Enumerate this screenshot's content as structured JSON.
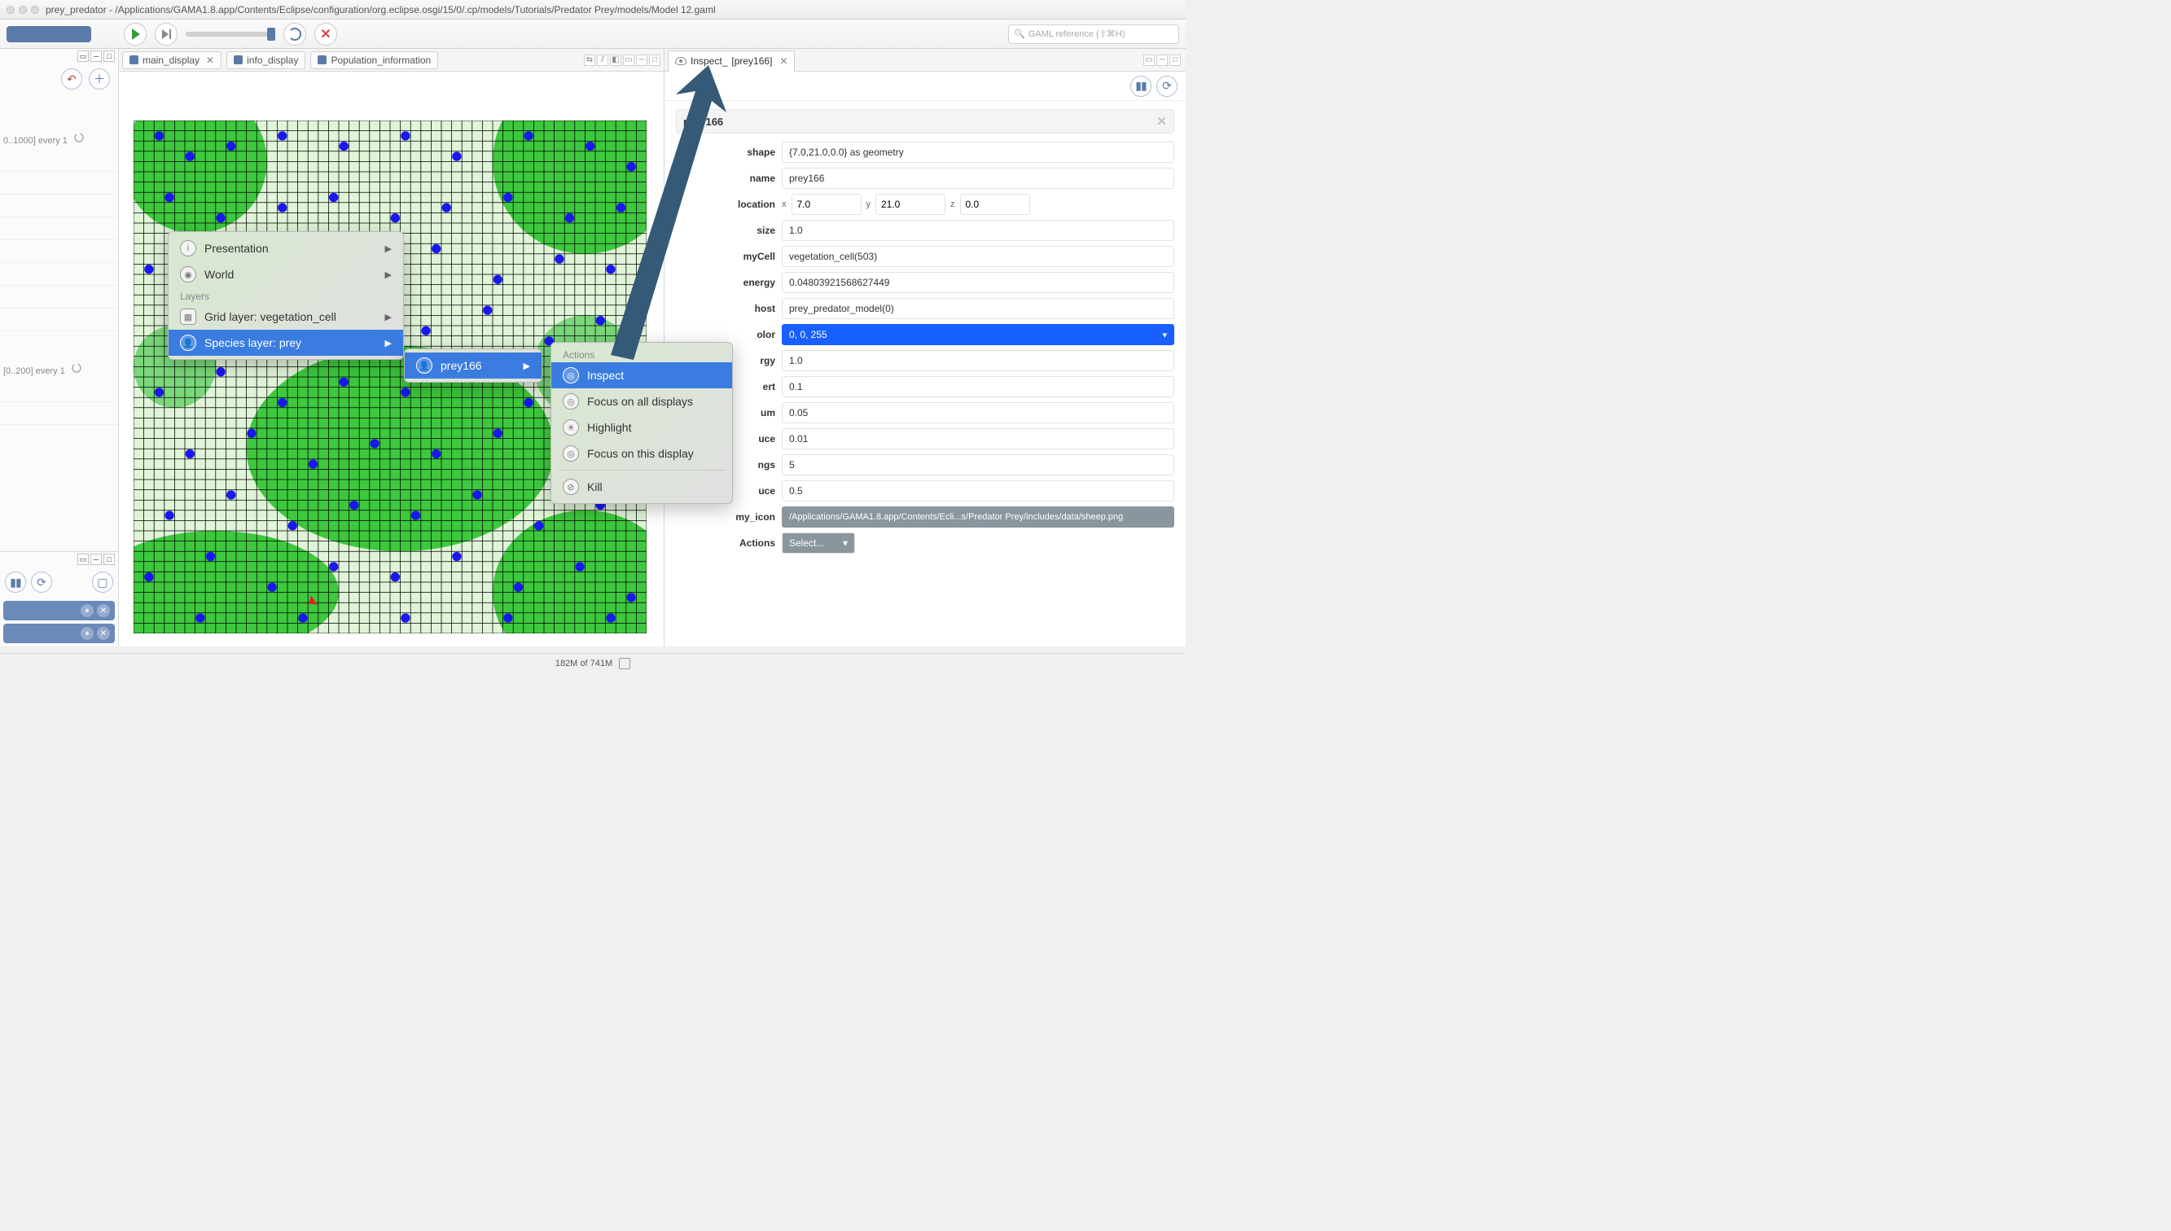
{
  "window": {
    "title": "prey_predator - /Applications/GAMA1.8.app/Contents/Eclipse/configuration/org.eclipse.osgi/15/0/.cp/models/Tutorials/Predator Prey/models/Model 12.gaml"
  },
  "toolbar": {
    "search_placeholder": "GAML reference (⇧⌘H)"
  },
  "left": {
    "param1": "0..1000] every 1",
    "param2": "[0..200] every 1"
  },
  "tabs": {
    "t1": "main_display",
    "t2": "info_display",
    "t3": "Population_information"
  },
  "inspect": {
    "tab_label_a": "Inspect_",
    "tab_label_b": "[prey166]",
    "agent_name": "prey166",
    "fields": {
      "shape": {
        "label": "shape",
        "value": "{7.0,21.0,0.0} as geometry"
      },
      "name": {
        "label": "name",
        "value": "prey166"
      },
      "location": {
        "label": "location",
        "xl": "x",
        "x": "7.0",
        "yl": "y",
        "y": "21.0",
        "zl": "z",
        "z": "0.0"
      },
      "size": {
        "label": "size",
        "value": "1.0"
      },
      "myCell": {
        "label": "myCell",
        "value": "vegetation_cell(503)"
      },
      "energy": {
        "label": "energy",
        "value": "0.04803921568627449"
      },
      "host": {
        "label": "host",
        "value": "prey_predator_model(0)"
      },
      "color": {
        "label": "olor",
        "value": "0, 0, 255"
      },
      "max_energy": {
        "label": "rgy",
        "value": "1.0"
      },
      "energy_transfert": {
        "label": "ert",
        "value": "0.1"
      },
      "energy_consum": {
        "label": "um",
        "value": "0.05"
      },
      "proba_reproduce": {
        "label": "uce",
        "value": "0.01"
      },
      "nb_max_offsprings": {
        "label": "ngs",
        "value": "5"
      },
      "energy_reproduce": {
        "label": "uce",
        "value": "0.5"
      },
      "my_icon": {
        "label": "my_icon",
        "value": "/Applications/GAMA1.8.app/Contents/Ecli...s/Predator Prey/includes/data/sheep.png"
      },
      "actions": {
        "label": "Actions",
        "value": "Select..."
      }
    }
  },
  "context_menu": {
    "presentation": "Presentation",
    "world": "World",
    "layers_hdr": "Layers",
    "grid_layer": "Grid layer: vegetation_cell",
    "species_layer": "Species layer: prey",
    "sub_prey": "prey166",
    "actions_hdr": "Actions",
    "inspect": "Inspect",
    "focus_all": "Focus on all displays",
    "highlight": "Highlight",
    "focus_this": "Focus on this display",
    "kill": "Kill"
  },
  "status": {
    "memory": "182M of 741M"
  }
}
